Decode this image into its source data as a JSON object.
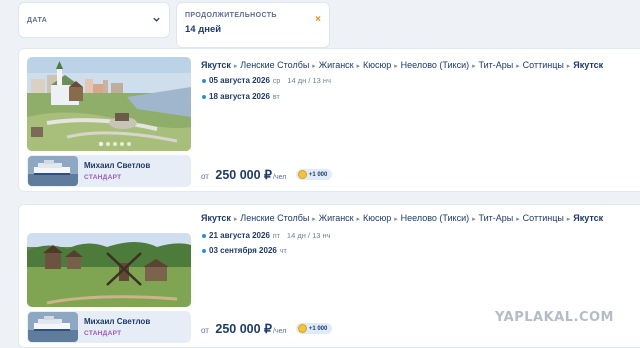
{
  "filters": {
    "date_label": "ДАТА",
    "duration_label": "ПРОДОЛЖИТЕЛЬНОСТЬ",
    "duration_value": "14 дней",
    "clear_icon": "×"
  },
  "cruises": [
    {
      "route": [
        "Якутск",
        "Ленские Столбы",
        "Жиганск",
        "Кюсюр",
        "Неелово (Тикси)",
        "Тит-Ары",
        "Соттинцы",
        "Якутск"
      ],
      "start_date": "05 августа 2026",
      "start_weekday": "ср",
      "duration": "14 дн / 13 нч",
      "end_date": "18 августа 2026",
      "end_weekday": "вт",
      "ship_name": "Михаил Светлов",
      "ship_class": "СТАНДАРТ",
      "price_prefix": "от",
      "price": "250 000 ₽",
      "price_unit": "/чел",
      "bonus": "+1 000"
    },
    {
      "route": [
        "Якутск",
        "Ленские Столбы",
        "Жиганск",
        "Кюсюр",
        "Неелово (Тикси)",
        "Тит-Ары",
        "Соттинцы",
        "Якутск"
      ],
      "start_date": "21 августа 2026",
      "start_weekday": "пт",
      "duration": "14 дн / 13 нч",
      "end_date": "03 сентября 2026",
      "end_weekday": "чт",
      "ship_name": "Михаил Светлов",
      "ship_class": "СТАНДАРТ",
      "price_prefix": "от",
      "price": "250 000 ₽",
      "price_unit": "/чел",
      "bonus": "+1 000"
    }
  ],
  "watermark": "YAPLAKAL.COM",
  "colors": {
    "accent": "#1f3a68",
    "clear": "#f08a1f",
    "date_dot": "#2d8fd5",
    "class": "#9b59b6",
    "coin": "#f3c33b"
  }
}
